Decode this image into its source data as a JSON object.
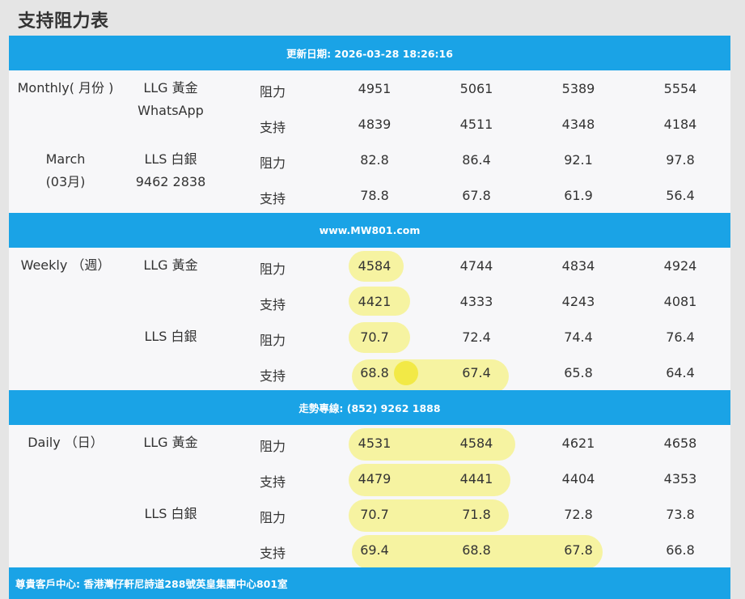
{
  "page_title": "支持阻力表",
  "bands": {
    "update": "更新日期: 2026-03-28 18:26:16",
    "website": "www.MW801.com",
    "hotline": "走勢專線: (852) 9262 1888",
    "address": "尊貴客戶中心: 香港灣仔軒尼詩道288號英皇集團中心801室"
  },
  "monthly": {
    "period_line1": "Monthly( 月份 )",
    "period_line2": "March",
    "period_line3": "(03月)",
    "gold_name": "LLG 黃金",
    "gold_extra": "WhatsApp",
    "silver_name": "LLS 白銀",
    "silver_extra": "9462 2838",
    "gold_resistance": [
      "4951",
      "5061",
      "5389",
      "5554"
    ],
    "gold_support": [
      "4839",
      "4511",
      "4348",
      "4184"
    ],
    "silver_resistance": [
      "82.8",
      "86.4",
      "92.1",
      "97.8"
    ],
    "silver_support": [
      "78.8",
      "67.8",
      "61.9",
      "56.4"
    ]
  },
  "weekly": {
    "period": "Weekly （週）",
    "gold_name": "LLG 黃金",
    "silver_name": "LLS 白銀",
    "gold_resistance": [
      "4584",
      "4744",
      "4834",
      "4924"
    ],
    "gold_support": [
      "4421",
      "4333",
      "4243",
      "4081"
    ],
    "silver_resistance": [
      "70.7",
      "72.4",
      "74.4",
      "76.4"
    ],
    "silver_support": [
      "68.8",
      "67.4",
      "65.8",
      "64.4"
    ]
  },
  "daily": {
    "period": "Daily （日）",
    "gold_name": "LLG 黃金",
    "silver_name": "LLS 白銀",
    "gold_resistance": [
      "4531",
      "4584",
      "4621",
      "4658"
    ],
    "gold_support": [
      "4479",
      "4441",
      "4404",
      "4353"
    ],
    "silver_resistance": [
      "70.7",
      "71.8",
      "72.8",
      "73.8"
    ],
    "silver_support": [
      "69.4",
      "68.8",
      "67.8",
      "66.8"
    ]
  },
  "labels": {
    "resistance": "阻力",
    "support": "支持"
  },
  "colors": {
    "band": "#1aa3e6",
    "highlight": "#f5f05a"
  }
}
